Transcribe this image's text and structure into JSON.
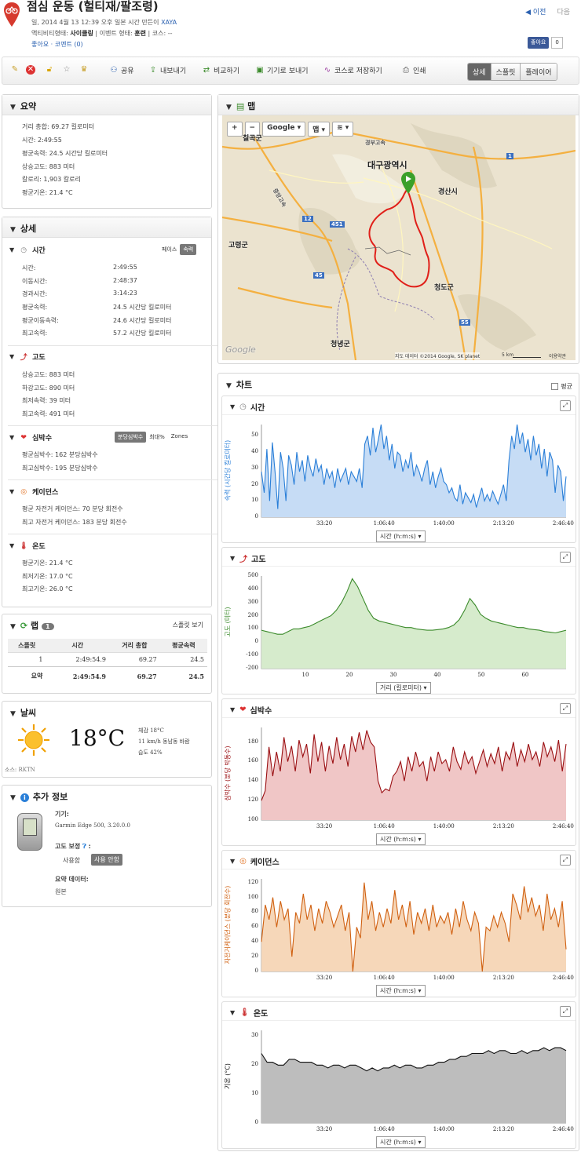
{
  "header": {
    "title": "점심 운동 (헐티재/팔조령)",
    "date_line": "일, 2014 4월 13 12:39 오후 일본 시간 만든이",
    "author": "XAYA",
    "activity_type_label": "액티비티형태:",
    "activity_type": "사이클링",
    "event_type_label": "| 이벤트 형태:",
    "event_type": "훈련",
    "course_label": "| 코스:",
    "course": "--",
    "likes": "좋아요",
    "comments": "· 코멘트 (0)",
    "prev": "◀ 이전",
    "next": "다음",
    "fb_like": "좋아요",
    "fb_count": "0"
  },
  "toolbar": {
    "share": "공유",
    "export": "내보내기",
    "compare": "비교하기",
    "send_device": "기기로 보내기",
    "save_course": "코스로 저장하기",
    "print": "인쇄",
    "views": [
      "상세",
      "스플릿",
      "플레이어"
    ]
  },
  "summary": {
    "title": "요약",
    "rows": [
      "거리 총합:  69.27 킬로미터",
      "시간:         2:49:55",
      "평균속력:  24.5 시간당 킬로미터",
      "상승고도:  883 미터",
      "칼로리:     1,903 칼로리",
      "평균기온:  21.4 °C"
    ]
  },
  "detail": {
    "title": "상세",
    "time": {
      "title": "시간",
      "toggle": [
        "페이스",
        "속력"
      ],
      "rows": [
        [
          "시간:",
          "2:49:55"
        ],
        [
          "이동시간:",
          "2:48:37"
        ],
        [
          "경과시간:",
          "3:14:23"
        ],
        [
          "평균속력:",
          "24.5 시간당 킬로미터"
        ],
        [
          "평균이동속력:",
          "24.6 시간당 킬로미터"
        ],
        [
          "최고속력:",
          "57.2 시간당 킬로미터"
        ]
      ]
    },
    "elev": {
      "title": "고도",
      "rows": [
        "상승고도:  883 미터",
        "하강고도:  890 미터",
        "최저속력:  39 미터",
        "최고속력:  491 미터"
      ]
    },
    "hr": {
      "title": "심박수",
      "toggle": [
        "분당심박수",
        "최대%",
        "Zones"
      ],
      "rows": [
        "평균심박수:  162 분당심박수",
        "최고심박수:  195 분당심박수"
      ]
    },
    "cad": {
      "title": "케이던스",
      "rows": [
        "평균 자전거 케이던스:  70 분당 회전수",
        "최고 자전거 케이던스:  183 분당 회전수"
      ]
    },
    "temp": {
      "title": "온도",
      "rows": [
        "평균기온:  21.4 °C",
        "최저기온:  17.0 °C",
        "최고기온:  26.0 °C"
      ]
    }
  },
  "laps": {
    "title": "랩",
    "count": "1",
    "split_view": "스플릿 보기",
    "headers": [
      "스플릿",
      "시간",
      "거리 총합",
      "평균속력"
    ],
    "row": [
      "1",
      "2:49:54.9",
      "69.27",
      "24.5"
    ],
    "summary": [
      "요약",
      "2:49:54.9",
      "69.27",
      "24.5"
    ]
  },
  "weather": {
    "title": "날씨",
    "temp": "18°C",
    "feels": "체감 18°C",
    "wind": "11 km/h 동남동 바람",
    "humidity": "습도 42%",
    "source": "소스: RKTN"
  },
  "extra": {
    "title": "추가 정보",
    "device_label": "기기:",
    "device": "Garmin Edge 500, 3.20.0.0",
    "elev_corr_label": "고도 보정",
    "elev_corr_opts": [
      "사용함",
      "사용 안함"
    ],
    "summary_data_label": "요약 데이터:",
    "summary_data": "원본"
  },
  "map": {
    "title": "맵",
    "controls": [
      "+",
      "−",
      "Google ▾",
      "맵 ▾",
      "≋ ▾"
    ],
    "labels": [
      "대구광역시",
      "경산시",
      "고령군",
      "청도군",
      "청녕군",
      "칠곡군"
    ],
    "roads": [
      "경부고속",
      "중앙고속",
      "12",
      "451",
      "45",
      "55",
      "1"
    ],
    "attribution": "지도 데이터 ©2014 Google, SK planet",
    "scale": "5 km",
    "terms": "이용약관",
    "google": "Google"
  },
  "charts": {
    "title": "차트",
    "avg": "평균"
  },
  "chart_data": [
    {
      "name": "시간",
      "type": "area",
      "color": "#2a7fd8",
      "fill": "#c6dcf5",
      "ylabel": "속력 (시간당 킬로미터)",
      "xlabel": "시간 (h:m:s)",
      "yticks": [
        "0",
        "10",
        "20",
        "30",
        "40",
        "50"
      ],
      "xticks": [
        "33:20",
        "1:06:40",
        "1:40:00",
        "2:13:20",
        "2:46:40"
      ],
      "ylim": [
        0,
        57
      ],
      "values": [
        28,
        15,
        42,
        10,
        46,
        28,
        5,
        40,
        30,
        10,
        38,
        32,
        20,
        40,
        28,
        35,
        22,
        38,
        30,
        25,
        36,
        28,
        32,
        20,
        30,
        24,
        28,
        18,
        30,
        22,
        26,
        30,
        20,
        28,
        25,
        22,
        30,
        18,
        45,
        50,
        38,
        55,
        40,
        48,
        58,
        42,
        50,
        35,
        45,
        30,
        40,
        38,
        28,
        35,
        30,
        40,
        25,
        32,
        28,
        22,
        30,
        35,
        20,
        28,
        18,
        25,
        30,
        22,
        20,
        15,
        18,
        12,
        10,
        20,
        8,
        15,
        12,
        9,
        14,
        6,
        12,
        18,
        10,
        14,
        10,
        16,
        12,
        8,
        14,
        20,
        10,
        35,
        50,
        42,
        58,
        45,
        52,
        40,
        48,
        35,
        50,
        38,
        45,
        30,
        42,
        25,
        40,
        35,
        15,
        32,
        28,
        10,
        25
      ]
    },
    {
      "name": "고도",
      "type": "area",
      "color": "#3a8a2a",
      "fill": "#d6ebcc",
      "ylabel": "고도 (미터)",
      "xlabel": "거리 (킬로미터)",
      "yticks": [
        "-200",
        "-100",
        "0",
        "100",
        "200",
        "300",
        "400",
        "500"
      ],
      "xticks": [
        "10",
        "20",
        "30",
        "40",
        "50",
        "60"
      ],
      "ylim": [
        -200,
        500
      ],
      "xlim": [
        0,
        69.3
      ],
      "values": [
        90,
        80,
        70,
        60,
        60,
        80,
        100,
        100,
        110,
        120,
        140,
        160,
        180,
        200,
        240,
        300,
        380,
        480,
        420,
        330,
        240,
        180,
        160,
        150,
        140,
        130,
        120,
        110,
        110,
        100,
        95,
        90,
        90,
        95,
        100,
        110,
        130,
        170,
        240,
        330,
        280,
        210,
        180,
        160,
        150,
        140,
        130,
        120,
        110,
        110,
        100,
        95,
        90,
        80,
        75,
        70,
        80,
        90
      ]
    },
    {
      "name": "심박수",
      "type": "area",
      "color": "#9a0f12",
      "fill": "#f0c6c6",
      "ylabel": "심박수 (분당 박동수)",
      "xlabel": "시간 (h:m:s)",
      "yticks": [
        "100",
        "120",
        "140",
        "160",
        "180"
      ],
      "xticks": [
        "33:20",
        "1:06:40",
        "1:40:00",
        "2:13:20",
        "2:46:40"
      ],
      "ylim": [
        100,
        195
      ],
      "values": [
        120,
        130,
        175,
        145,
        170,
        150,
        185,
        160,
        176,
        150,
        182,
        165,
        178,
        148,
        188,
        160,
        180,
        150,
        176,
        158,
        185,
        162,
        178,
        155,
        186,
        170,
        190,
        172,
        192,
        180,
        175,
        140,
        128,
        132,
        130,
        145,
        150,
        160,
        140,
        165,
        150,
        170,
        155,
        160,
        140,
        165,
        150,
        170,
        158,
        162,
        150,
        175,
        160,
        152,
        170,
        158,
        165,
        148,
        160,
        172,
        155,
        168,
        158,
        175,
        150,
        170,
        162,
        180,
        155,
        172,
        160,
        178,
        162,
        170,
        155,
        180,
        165,
        175,
        160,
        182,
        150,
        178
      ]
    },
    {
      "name": "케이던스",
      "type": "area",
      "color": "#d06010",
      "fill": "#f6d7b9",
      "ylabel": "자전거케이던스 (분당 회전수)",
      "xlabel": "시간 (h:m:s)",
      "yticks": [
        "0",
        "20",
        "40",
        "60",
        "80",
        "100",
        "120"
      ],
      "xticks": [
        "33:20",
        "1:06:40",
        "1:40:00",
        "2:13:20",
        "2:46:40"
      ],
      "ylim": [
        0,
        125
      ],
      "values": [
        40,
        90,
        70,
        100,
        60,
        95,
        70,
        85,
        20,
        80,
        65,
        105,
        70,
        90,
        55,
        85,
        65,
        95,
        80,
        60,
        75,
        90,
        55,
        80,
        0,
        60,
        45,
        120,
        70,
        95,
        55,
        80,
        60,
        85,
        65,
        110,
        70,
        90,
        60,
        95,
        50,
        80,
        65,
        85,
        55,
        90,
        60,
        75,
        65,
        80,
        50,
        85,
        60,
        95,
        70,
        55,
        80,
        65,
        0,
        60,
        55,
        75,
        60,
        80,
        65,
        40,
        105,
        90,
        70,
        115,
        80,
        100,
        75,
        90,
        55,
        105,
        70,
        85,
        60,
        95,
        30
      ]
    },
    {
      "name": "온도",
      "type": "area",
      "color": "#111",
      "fill": "#bdbdbd",
      "ylabel": "기온 (°C)",
      "xlabel": "시간 (h:m:s)",
      "yticks": [
        "0",
        "10",
        "20",
        "30"
      ],
      "xticks": [
        "33:20",
        "1:06:40",
        "1:40:00",
        "2:13:20",
        "2:46:40"
      ],
      "ylim": [
        0,
        32
      ],
      "values": [
        24,
        21,
        21,
        20,
        20,
        22,
        22,
        21,
        21,
        21,
        20,
        20,
        19,
        20,
        20,
        19,
        20,
        20,
        19,
        18,
        19,
        18,
        19,
        19,
        20,
        19,
        20,
        20,
        19,
        19,
        20,
        20,
        21,
        21,
        22,
        22,
        23,
        23,
        24,
        24,
        24,
        25,
        24,
        25,
        25,
        24,
        24,
        25,
        24,
        25,
        25,
        26,
        25,
        26,
        26,
        25
      ]
    }
  ]
}
